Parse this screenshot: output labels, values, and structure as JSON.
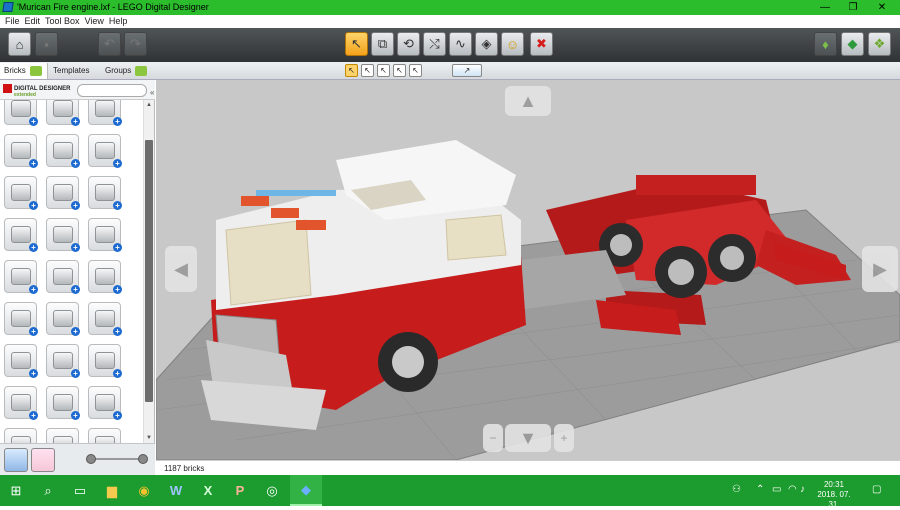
{
  "window": {
    "title": "'Murican Fire engine.lxf - LEGO Digital Designer",
    "minimize": "—",
    "maximize": "❐",
    "close": "✕"
  },
  "menu": [
    "File",
    "Edit",
    "Tool Box",
    "View",
    "Help"
  ],
  "toolbar": {
    "left": [
      {
        "name": "home-button",
        "icon": "home-icon",
        "glyph": "⌂"
      },
      {
        "name": "save-button",
        "icon": "save-icon",
        "glyph": "▪"
      },
      {
        "name": "undo-button",
        "icon": "undo-icon",
        "glyph": "↶"
      },
      {
        "name": "redo-button",
        "icon": "redo-icon",
        "glyph": "↷"
      }
    ],
    "tools": [
      {
        "name": "select-tool-button",
        "icon": "cursor-icon",
        "glyph": "↖",
        "selected": true
      },
      {
        "name": "clone-tool-button",
        "icon": "clone-icon",
        "glyph": "⧉"
      },
      {
        "name": "hinge-tool-button",
        "icon": "hinge-icon",
        "glyph": "⟲"
      },
      {
        "name": "hinge-align-tool-button",
        "icon": "hinge-align-icon",
        "glyph": "⤭"
      },
      {
        "name": "flex-tool-button",
        "icon": "flex-icon",
        "glyph": "∿"
      },
      {
        "name": "paint-tool-button",
        "icon": "paint-bucket-icon",
        "glyph": "◈"
      },
      {
        "name": "decoration-tool-button",
        "icon": "minifig-head-icon",
        "glyph": "☺"
      },
      {
        "name": "delete-tool-button",
        "icon": "delete-icon",
        "glyph": "✖"
      }
    ],
    "right": [
      {
        "name": "build-mode-button",
        "icon": "build-mode-icon",
        "glyph": "♦"
      },
      {
        "name": "view-mode-button",
        "icon": "view-mode-icon",
        "glyph": "◆"
      },
      {
        "name": "instructions-mode-button",
        "icon": "instructions-icon",
        "glyph": "❖"
      }
    ]
  },
  "panel_tabs": [
    {
      "label": "Bricks",
      "icon": "bricks-icon"
    },
    {
      "label": "Templates",
      "icon": "templates-icon"
    },
    {
      "label": "Groups",
      "icon": "groups-icon"
    }
  ],
  "logo": {
    "text": "DIGITAL DESIGNER",
    "sub": "extended"
  },
  "search": {
    "placeholder": ""
  },
  "subtools": [
    "select-single-icon",
    "select-connected-icon",
    "select-same-color-icon",
    "select-same-shape-icon",
    "select-invert-icon"
  ],
  "subtool_extra": "camera-view-icon",
  "status": {
    "brick_count": "1187 bricks"
  },
  "taskbar": {
    "apps": [
      {
        "name": "start-button",
        "icon": "windows-icon",
        "glyph": "⊞"
      },
      {
        "name": "search-button",
        "icon": "search-icon",
        "glyph": "⌕"
      },
      {
        "name": "task-view-button",
        "icon": "task-view-icon",
        "glyph": "▭"
      },
      {
        "name": "file-explorer-button",
        "icon": "folder-icon",
        "glyph": "▆"
      },
      {
        "name": "chrome-button",
        "icon": "chrome-icon",
        "glyph": "◉"
      },
      {
        "name": "word-button",
        "icon": "word-icon",
        "glyph": "W"
      },
      {
        "name": "excel-button",
        "icon": "excel-icon",
        "glyph": "X"
      },
      {
        "name": "powerpoint-button",
        "icon": "powerpoint-icon",
        "glyph": "P"
      },
      {
        "name": "app-button",
        "icon": "ring-app-icon",
        "glyph": "◎"
      },
      {
        "name": "lego-designer-button",
        "icon": "lego-designer-icon",
        "glyph": "◆",
        "active": true
      }
    ],
    "time": "20:31",
    "date": "2018. 07. 31."
  },
  "colors": {
    "titlebar": "#2bbd2b",
    "taskbar": "#1c9b2e",
    "viewport": "#c8c8c8",
    "brick_red": "#c81e1e",
    "brick_white": "#f2f2f2",
    "baseplate": "#9b9b9b"
  }
}
